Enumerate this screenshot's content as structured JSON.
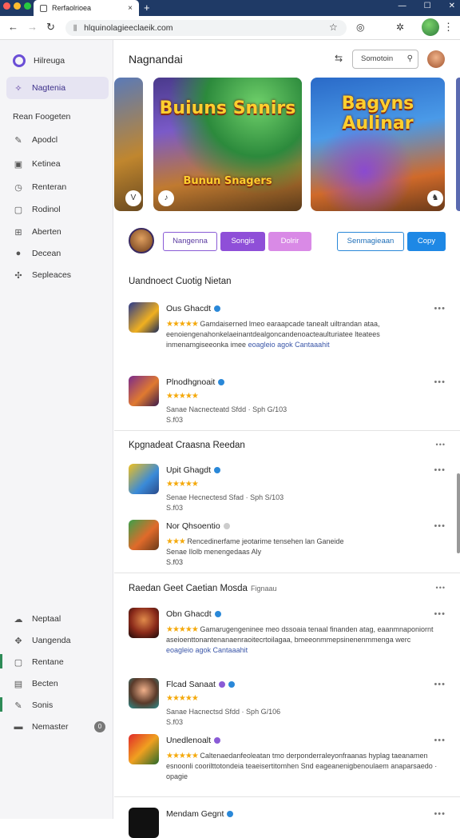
{
  "browser": {
    "tab_title": "Rerfaolrioea",
    "tab_close": "×",
    "new_tab": "+",
    "url": "hlquinolagieeclaeik.com",
    "window_controls": [
      "—",
      "☐",
      "✕"
    ]
  },
  "sidebar": {
    "items": [
      {
        "label": "Hilreuga",
        "icon": "brand-logo-icon"
      },
      {
        "label": "Nagtenia",
        "icon": "star-icon",
        "active": true
      },
      {
        "label": "Rean Foogeten",
        "icon": ""
      },
      {
        "label": "Apodcl",
        "icon": "pin-icon"
      },
      {
        "label": "Ketinea",
        "icon": "grid-icon"
      },
      {
        "label": "Renteran",
        "icon": "clock-icon"
      },
      {
        "label": "Rodinol",
        "icon": "box-icon"
      },
      {
        "label": "Aberten",
        "icon": "grid-icon"
      },
      {
        "label": "Decean",
        "icon": "circle-icon"
      },
      {
        "label": "Sepleaces",
        "icon": "sparkle-icon"
      }
    ],
    "bottom_items": [
      {
        "label": "Neptaal",
        "icon": "cloud-icon"
      },
      {
        "label": "Uangenda",
        "icon": "gamepad-icon"
      },
      {
        "label": "Rentane",
        "icon": "box-icon"
      },
      {
        "label": "Becten",
        "icon": "chart-icon"
      },
      {
        "label": "Sonis",
        "icon": "pin-icon"
      },
      {
        "label": "Nemaster",
        "icon": "folder-icon",
        "badge": "0"
      }
    ]
  },
  "header": {
    "title": "Nagnandai",
    "search_placeholder": "Somotoin"
  },
  "banners": [
    {
      "title": "",
      "subtitle": ""
    },
    {
      "title": "Buiuns Snnirs",
      "subtitle": "Bunun Snagers"
    },
    {
      "title": "Bagyns Aulinar",
      "subtitle": ""
    }
  ],
  "actions": {
    "btn1": "Nangenna",
    "btn2": "Songis",
    "btn3": "Dolrir",
    "btn4": "Senmagieaan",
    "btn5": "Copy"
  },
  "sections": [
    {
      "title": "Uandnoect Cuotig Nietan",
      "reviews": [
        {
          "name": "Ous Ghacdt",
          "text": "Gamdaiserned lmeo earaapcade tanealt uiltrandan ataa, eenoiengenahonkelaeinantdealgoncandenoacteaulturiatee lteatees inmenamgiseeonka imee",
          "link": "eoagleio agok Cantaaahit"
        },
        {
          "name": "Plnodhgnoait",
          "meta1": "Sanae Nacnecteatd Sfdd · Sph G/103",
          "meta2": "S.f03"
        }
      ]
    },
    {
      "title": "Kpgnadeat Craasna Reedan",
      "reviews": [
        {
          "name": "Upit Ghagdt",
          "meta1": "Senae Hecnectesd Sfad · Sph S/103",
          "meta2": "S.f03"
        },
        {
          "name": "Nor Qhsoentio",
          "text": "Rencedinerfame jeotarime tensehen lan Ganeide",
          "meta1": "Senae Ilolb menengedaas Aly",
          "meta2": "S.f03"
        }
      ]
    },
    {
      "title": "Raedan Geet Caetian Mosda",
      "subtitle": "Fignaau",
      "reviews": [
        {
          "name": "Obn Ghacdt",
          "text": "Gamarugengeninee meo dssoaia tenaal finanden atag, eaanmnaponiornt aseioenttonantenanaenraoitecrtoilagaa, bmeeonmmepsinenenmmenga werc",
          "link": "eoagleio agok Cantaaahit"
        },
        {
          "name": "Flcad Sanaat",
          "meta1": "Sanae Hacnectsd Sfdd · Sph G/106",
          "meta2": "S.f03"
        },
        {
          "name": "Unedlenoalt",
          "text": "Caltenaedanfeoleatan tmo derponderraleyonfraanas hyplag taeanamen esnoonli coorilttotondeia teaeisertitomhen Snd eageanenigbenoulaem anaparsaedo · opagie"
        },
        {
          "name": "Mendam Gegnt"
        }
      ]
    }
  ],
  "more_glyph": "•••",
  "colors": {
    "accent_purple": "#8f4fd8",
    "accent_pink": "#d98ae6",
    "accent_blue": "#1e88e5",
    "star": "#f4a90c",
    "link": "#3a56a8"
  }
}
